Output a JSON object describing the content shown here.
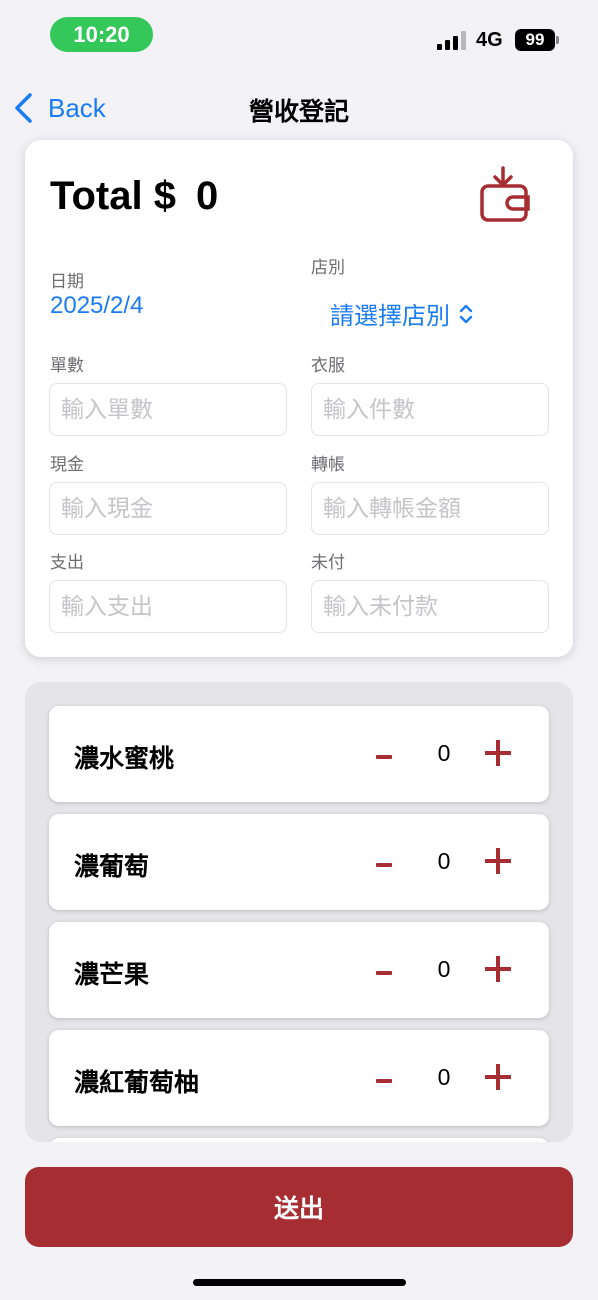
{
  "status_bar": {
    "time": "10:20",
    "network": "4G",
    "battery": "99",
    "time_pill_color": "#34c759"
  },
  "nav": {
    "back_label": "Back",
    "title": "營收登記"
  },
  "summary": {
    "total_label": "Total $",
    "total_value": "0",
    "date_label": "日期",
    "date_value": "2025/2/4",
    "store_label": "店別",
    "store_value": "請選擇店別",
    "fields": {
      "orders": {
        "label": "單數",
        "placeholder": "輸入單數"
      },
      "clothes": {
        "label": "衣服",
        "placeholder": "輸入件數"
      },
      "cash": {
        "label": "現金",
        "placeholder": "輸入現金"
      },
      "transfer": {
        "label": "轉帳",
        "placeholder": "輸入轉帳金額"
      },
      "expense": {
        "label": "支出",
        "placeholder": "輸入支出"
      },
      "unpaid": {
        "label": "未付",
        "placeholder": "輸入未付款"
      }
    }
  },
  "products": [
    {
      "name": "濃水蜜桃",
      "qty": "0"
    },
    {
      "name": "濃葡萄",
      "qty": "0"
    },
    {
      "name": "濃芒果",
      "qty": "0"
    },
    {
      "name": "濃紅葡萄柚",
      "qty": "0"
    }
  ],
  "submit_label": "送出",
  "colors": {
    "accent_red": "#a62d32",
    "link_blue": "#1a7cf4",
    "background": "#f2f2f7"
  },
  "icons": {
    "back": "chevron-left-icon",
    "wallet": "wallet-download-icon",
    "store_picker": "chevron-up-down-icon"
  }
}
